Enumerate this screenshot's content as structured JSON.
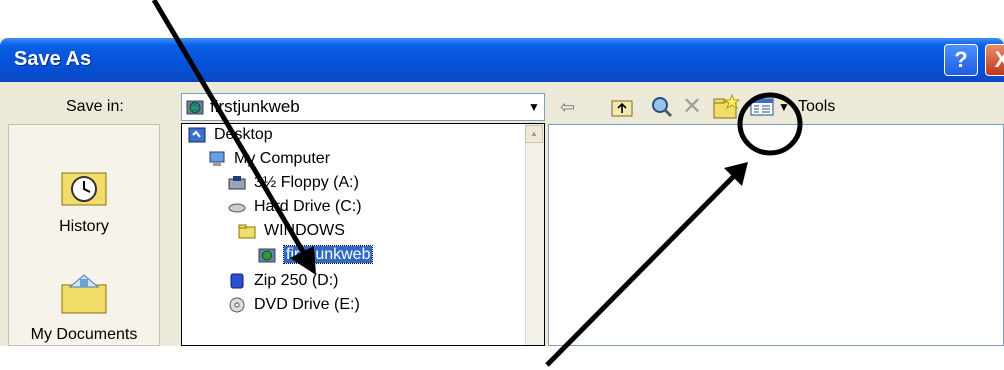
{
  "window": {
    "title": "Save As",
    "help_label": "?",
    "close_label": "X"
  },
  "save_in": {
    "label": "Save in:",
    "current": "firstjunkweb"
  },
  "toolbar": {
    "back_icon": "back-arrow-icon",
    "up_folder_icon": "up-one-level-icon",
    "search_web_icon": "search-web-icon",
    "delete_icon": "delete-icon",
    "new_folder_icon": "create-new-folder-icon",
    "views_icon": "views-icon",
    "tools_label": "Tools"
  },
  "places": [
    {
      "label": "History",
      "icon": "history-icon"
    },
    {
      "label": "My Documents",
      "icon": "my-documents-icon"
    }
  ],
  "dropdown_items": [
    {
      "label": "Desktop",
      "icon": "desktop-icon",
      "level": 0
    },
    {
      "label": "My Computer",
      "icon": "my-computer-icon",
      "level": 1
    },
    {
      "label": "3½ Floppy (A:)",
      "icon": "floppy-icon",
      "level": 2
    },
    {
      "label": "Hard Drive (C:)",
      "icon": "hard-drive-icon",
      "level": 2
    },
    {
      "label": "WINDOWS",
      "icon": "folder-icon",
      "level": 3
    },
    {
      "label": "firstjunkweb",
      "icon": "web-folder-icon",
      "level": 4,
      "selected": true
    },
    {
      "label": "Zip 250  (D:)",
      "icon": "zip-drive-icon",
      "level": 2
    },
    {
      "label": "DVD Drive (E:)",
      "icon": "dvd-drive-icon",
      "level": 2
    }
  ],
  "colors": {
    "titlebar": "#0552d8",
    "selection": "#316ac5",
    "dialog_bg": "#ece9d8"
  }
}
